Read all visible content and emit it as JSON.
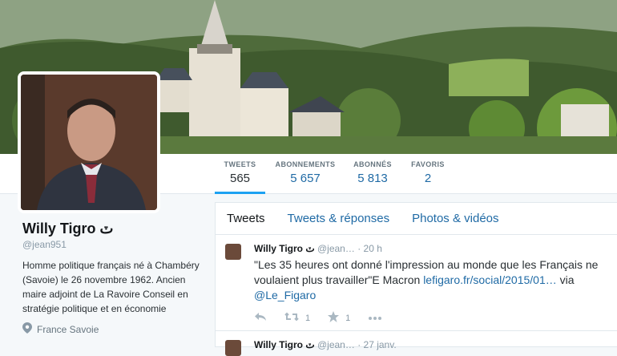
{
  "stats": {
    "tweets_label": "TWEETS",
    "tweets_value": "565",
    "following_label": "ABONNEMENTS",
    "following_value": "5 657",
    "followers_label": "ABONNÉS",
    "followers_value": "5 813",
    "likes_label": "FAVORIS",
    "likes_value": "2"
  },
  "profile": {
    "name": "Willy Tigro ٽ",
    "handle": "@jean951",
    "bio": "Homme politique français né à Chambéry (Savoie) le 26 novembre 1962. Ancien maire adjoint de La Ravoire Conseil en stratégie politique et en économie",
    "location": "France Savoie"
  },
  "feed": {
    "tabs": [
      "Tweets",
      "Tweets & réponses",
      "Photos & vidéos"
    ],
    "tweets": [
      {
        "name": "Willy Tigro ٽ",
        "handle": "@jean…",
        "time": "· 20 h",
        "text": "\"Les 35 heures ont donné l'impression au monde que les Français ne voulaient plus travailler\"E Macron",
        "link": "lefigaro.fr/social/2015/01…",
        "via": "via",
        "mention": "@Le_Figaro",
        "retweets": "1",
        "likes": "1"
      },
      {
        "name": "Willy Tigro ٽ",
        "handle": "@jean…",
        "time": "· 27 janv."
      }
    ]
  },
  "colors": {
    "accent": "#1da1f2",
    "link": "#1f6aa5"
  },
  "icons": [
    "reply-icon",
    "retweet-icon",
    "like-icon",
    "more-icon",
    "location-icon"
  ]
}
